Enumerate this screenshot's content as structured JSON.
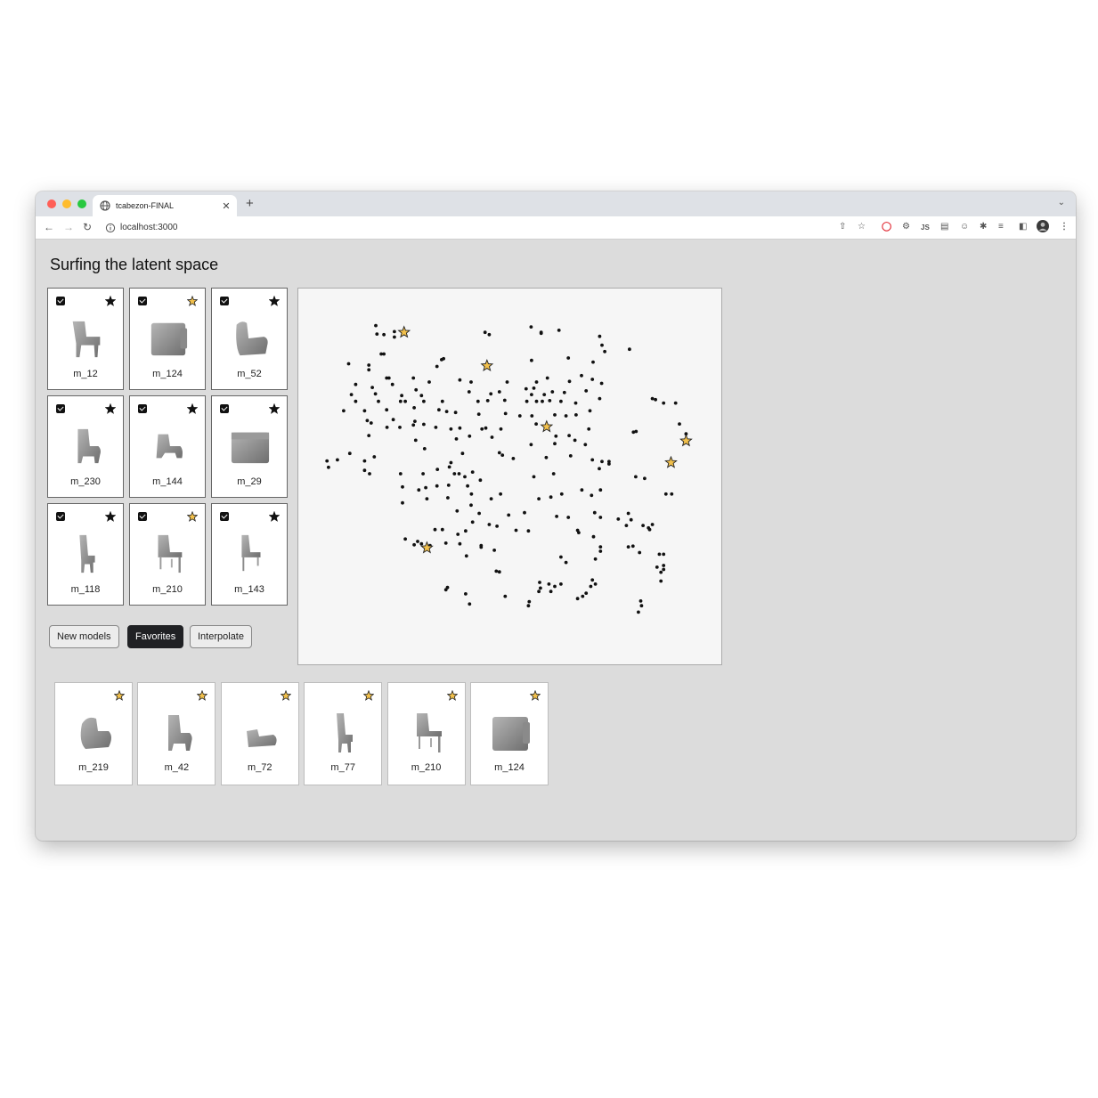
{
  "browser": {
    "tab_title": "tcabezon-FINAL",
    "new_tab_symbol": "+",
    "tab_close_symbol": "✕",
    "url": "localhost:3000",
    "extensions": [
      "share-icon",
      "bookmark-star-icon",
      "opera-icon",
      "gear-extension-icon",
      "js-extension-icon",
      "document-extension-icon",
      "smiley-extension-icon",
      "puzzle-icon",
      "media-list-icon",
      "sidebar-icon",
      "profile-avatar",
      "more-menu-icon"
    ],
    "js_label": "JS"
  },
  "page": {
    "title": "Surfing the latent space"
  },
  "grid_models": [
    {
      "label": "m_12",
      "checked": true,
      "favorite": false,
      "shape": "chair-armless"
    },
    {
      "label": "m_124",
      "checked": true,
      "favorite": true,
      "shape": "box-sofa"
    },
    {
      "label": "m_52",
      "checked": true,
      "favorite": false,
      "shape": "armchair"
    },
    {
      "label": "m_230",
      "checked": true,
      "favorite": false,
      "shape": "armchair-tall"
    },
    {
      "label": "m_144",
      "checked": true,
      "favorite": false,
      "shape": "armchair-low"
    },
    {
      "label": "m_29",
      "checked": true,
      "favorite": false,
      "shape": "box-sofa-wide"
    },
    {
      "label": "m_118",
      "checked": true,
      "favorite": false,
      "shape": "chair-slim"
    },
    {
      "label": "m_210",
      "checked": true,
      "favorite": true,
      "shape": "chair-legs"
    },
    {
      "label": "m_143",
      "checked": true,
      "favorite": false,
      "shape": "chair-legs-slim"
    }
  ],
  "buttons": {
    "new_models": "New models",
    "favorites": "Favorites",
    "interpolate": "Interpolate",
    "active": "favorites"
  },
  "favorites": [
    {
      "label": "m_219",
      "shape": "round-armchair"
    },
    {
      "label": "m_42",
      "shape": "armchair-tall"
    },
    {
      "label": "m_72",
      "shape": "low-seat"
    },
    {
      "label": "m_77",
      "shape": "chair-slim"
    },
    {
      "label": "m_210",
      "shape": "chair-legs"
    },
    {
      "label": "m_124",
      "shape": "box-sofa"
    }
  ],
  "colors": {
    "favorite_star": "#f2c04b",
    "star_outline": "#222222",
    "plain_star": "#111111",
    "active_button": "#202124",
    "window_bg": "#dcdcdc",
    "plot_bg": "#f6f6f6"
  },
  "chart_data": {
    "type": "scatter",
    "title": "",
    "xlabel": "",
    "ylabel": "",
    "grid": false,
    "axes": false,
    "xlim": [
      0,
      100
    ],
    "ylim": [
      0,
      100
    ],
    "series": [
      {
        "marker": "dot",
        "points": [
          [
            15.4,
            93.8
          ],
          [
            15.7,
            91.3
          ],
          [
            17.5,
            91.1
          ],
          [
            20.2,
            92.0
          ],
          [
            20.2,
            90.4
          ],
          [
            43.6,
            91.8
          ],
          [
            44.7,
            91.1
          ],
          [
            55.5,
            93.4
          ],
          [
            58.1,
            91.5
          ],
          [
            58.1,
            91.8
          ],
          [
            62.7,
            92.4
          ],
          [
            73.2,
            90.6
          ],
          [
            73.8,
            88.0
          ],
          [
            74.5,
            86.1
          ],
          [
            80.9,
            86.8
          ],
          [
            16.8,
            85.4
          ],
          [
            17.5,
            85.4
          ],
          [
            32.4,
            83.7
          ],
          [
            32.9,
            84.0
          ],
          [
            31.2,
            81.7
          ],
          [
            55.6,
            83.5
          ],
          [
            65.1,
            84.2
          ],
          [
            71.5,
            83.0
          ],
          [
            8.4,
            82.5
          ],
          [
            13.6,
            82.1
          ],
          [
            13.6,
            80.7
          ],
          [
            18.2,
            78.3
          ],
          [
            18.8,
            78.3
          ],
          [
            25.1,
            78.3
          ],
          [
            29.2,
            77.1
          ],
          [
            37.1,
            77.7
          ],
          [
            40.0,
            77.1
          ],
          [
            49.3,
            77.1
          ],
          [
            56.9,
            77.1
          ],
          [
            59.7,
            78.3
          ],
          [
            65.4,
            77.3
          ],
          [
            68.5,
            79.0
          ],
          [
            71.3,
            77.9
          ],
          [
            73.7,
            76.7
          ],
          [
            10.2,
            76.4
          ],
          [
            14.5,
            75.5
          ],
          [
            19.7,
            76.4
          ],
          [
            25.8,
            74.8
          ],
          [
            9.1,
            73.4
          ],
          [
            15.3,
            73.6
          ],
          [
            22.1,
            73.1
          ],
          [
            27.2,
            73.1
          ],
          [
            39.5,
            74.2
          ],
          [
            45.1,
            73.6
          ],
          [
            47.3,
            74.2
          ],
          [
            54.2,
            75.1
          ],
          [
            55.6,
            73.4
          ],
          [
            56.2,
            75.3
          ],
          [
            58.9,
            73.4
          ],
          [
            61.0,
            74.2
          ],
          [
            64.1,
            74.0
          ],
          [
            69.7,
            74.5
          ],
          [
            21.8,
            71.4
          ],
          [
            10.2,
            71.4
          ],
          [
            16.1,
            71.4
          ],
          [
            23.0,
            71.4
          ],
          [
            27.8,
            71.4
          ],
          [
            32.6,
            71.4
          ],
          [
            41.8,
            71.4
          ],
          [
            44.3,
            71.6
          ],
          [
            48.7,
            71.7
          ],
          [
            54.4,
            71.4
          ],
          [
            56.9,
            71.4
          ],
          [
            58.4,
            71.4
          ],
          [
            60.3,
            71.6
          ],
          [
            63.2,
            71.4
          ],
          [
            67.0,
            70.9
          ],
          [
            73.2,
            72.2
          ],
          [
            86.8,
            72.2
          ],
          [
            87.6,
            71.9
          ],
          [
            89.7,
            70.9
          ],
          [
            92.8,
            70.9
          ],
          [
            7.1,
            68.6
          ],
          [
            12.5,
            68.6
          ],
          [
            18.2,
            68.9
          ],
          [
            25.3,
            69.5
          ],
          [
            31.7,
            68.9
          ],
          [
            33.7,
            68.4
          ],
          [
            36.0,
            68.1
          ],
          [
            42.0,
            67.6
          ],
          [
            48.9,
            67.8
          ],
          [
            52.6,
            67.1
          ],
          [
            55.7,
            67.1
          ],
          [
            61.6,
            67.4
          ],
          [
            64.5,
            67.1
          ],
          [
            67.1,
            67.4
          ],
          [
            70.7,
            68.6
          ],
          [
            19.9,
            66.0
          ],
          [
            25.5,
            65.5
          ],
          [
            13.2,
            65.7
          ],
          [
            14.2,
            65.0
          ],
          [
            18.3,
            63.7
          ],
          [
            21.6,
            63.7
          ],
          [
            25.1,
            64.4
          ],
          [
            27.8,
            64.6
          ],
          [
            30.9,
            63.7
          ],
          [
            34.8,
            63.2
          ],
          [
            37.1,
            63.5
          ],
          [
            42.8,
            63.2
          ],
          [
            43.8,
            63.5
          ],
          [
            47.7,
            63.2
          ],
          [
            56.8,
            64.7
          ],
          [
            70.4,
            63.2
          ],
          [
            81.9,
            62.3
          ],
          [
            82.6,
            62.5
          ],
          [
            93.8,
            64.7
          ],
          [
            95.5,
            61.8
          ],
          [
            13.6,
            61.3
          ],
          [
            25.7,
            59.9
          ],
          [
            36.2,
            60.3
          ],
          [
            39.6,
            61.1
          ],
          [
            45.4,
            60.8
          ],
          [
            55.5,
            58.6
          ],
          [
            61.6,
            58.9
          ],
          [
            61.9,
            61.1
          ],
          [
            65.3,
            61.3
          ],
          [
            66.8,
            59.9
          ],
          [
            69.5,
            58.6
          ],
          [
            28.0,
            57.4
          ],
          [
            8.7,
            56.0
          ],
          [
            15.0,
            55.0
          ],
          [
            34.8,
            53.3
          ],
          [
            31.3,
            51.3
          ],
          [
            34.4,
            52.0
          ],
          [
            37.8,
            56.0
          ],
          [
            47.3,
            56.2
          ],
          [
            48.1,
            55.5
          ],
          [
            50.9,
            54.5
          ],
          [
            59.4,
            54.8
          ],
          [
            65.7,
            55.3
          ],
          [
            71.3,
            54.1
          ],
          [
            73.8,
            53.6
          ],
          [
            75.6,
            52.9
          ],
          [
            75.6,
            53.6
          ],
          [
            73.1,
            51.5
          ],
          [
            82.5,
            49.1
          ],
          [
            84.8,
            48.6
          ],
          [
            2.8,
            53.8
          ],
          [
            5.5,
            54.1
          ],
          [
            12.5,
            53.8
          ],
          [
            3.2,
            51.9
          ],
          [
            12.5,
            51.0
          ],
          [
            13.8,
            50.0
          ],
          [
            21.8,
            50.0
          ],
          [
            27.6,
            50.0
          ],
          [
            35.7,
            50.0
          ],
          [
            36.9,
            50.0
          ],
          [
            38.4,
            49.1
          ],
          [
            40.4,
            50.5
          ],
          [
            42.4,
            48.1
          ],
          [
            56.2,
            49.1
          ],
          [
            61.3,
            50.0
          ],
          [
            22.3,
            46.1
          ],
          [
            26.5,
            45.2
          ],
          [
            28.3,
            45.9
          ],
          [
            31.2,
            46.4
          ],
          [
            34.2,
            46.6
          ],
          [
            39.1,
            46.4
          ],
          [
            40.1,
            44.0
          ],
          [
            28.6,
            42.6
          ],
          [
            34.0,
            42.9
          ],
          [
            45.2,
            42.6
          ],
          [
            47.6,
            44.0
          ],
          [
            57.5,
            42.6
          ],
          [
            60.6,
            43.1
          ],
          [
            63.4,
            44.0
          ],
          [
            68.6,
            45.2
          ],
          [
            71.1,
            43.6
          ],
          [
            73.4,
            45.2
          ],
          [
            90.3,
            44.0
          ],
          [
            91.8,
            44.0
          ],
          [
            22.3,
            41.4
          ],
          [
            40.0,
            40.7
          ],
          [
            36.4,
            39.0
          ],
          [
            42.1,
            38.3
          ],
          [
            49.7,
            37.8
          ],
          [
            53.8,
            38.5
          ],
          [
            62.1,
            37.4
          ],
          [
            65.1,
            37.1
          ],
          [
            71.9,
            38.5
          ],
          [
            73.4,
            37.1
          ],
          [
            78.0,
            36.6
          ],
          [
            81.3,
            36.4
          ],
          [
            80.6,
            38.3
          ],
          [
            80.1,
            34.7
          ],
          [
            84.4,
            34.7
          ],
          [
            86.1,
            33.5
          ],
          [
            85.8,
            34.0
          ],
          [
            86.8,
            35.0
          ],
          [
            30.7,
            33.5
          ],
          [
            32.6,
            33.5
          ],
          [
            36.6,
            32.1
          ],
          [
            38.6,
            33.1
          ],
          [
            40.4,
            35.7
          ],
          [
            44.7,
            35.0
          ],
          [
            46.7,
            34.5
          ],
          [
            51.6,
            33.3
          ],
          [
            54.8,
            33.1
          ],
          [
            67.5,
            33.3
          ],
          [
            71.6,
            31.4
          ],
          [
            67.8,
            32.6
          ],
          [
            73.4,
            28.4
          ],
          [
            80.6,
            28.4
          ],
          [
            81.8,
            28.6
          ],
          [
            83.5,
            26.7
          ],
          [
            88.6,
            26.2
          ],
          [
            89.7,
            26.2
          ],
          [
            38.8,
            25.7
          ],
          [
            23.0,
            30.7
          ],
          [
            25.3,
            29.0
          ],
          [
            26.2,
            30.0
          ],
          [
            27.2,
            29.3
          ],
          [
            29.4,
            28.8
          ],
          [
            33.5,
            29.5
          ],
          [
            37.1,
            29.3
          ],
          [
            42.6,
            28.8
          ],
          [
            42.6,
            28.3
          ],
          [
            46.0,
            27.4
          ],
          [
            63.2,
            25.4
          ],
          [
            64.5,
            23.8
          ],
          [
            72.1,
            24.8
          ],
          [
            73.4,
            27.1
          ],
          [
            88.0,
            22.4
          ],
          [
            89.7,
            22.9
          ],
          [
            89.7,
            21.7
          ],
          [
            89.0,
            20.9
          ],
          [
            89.0,
            18.3
          ],
          [
            46.5,
            21.2
          ],
          [
            47.3,
            21.0
          ],
          [
            57.7,
            17.9
          ],
          [
            60.1,
            17.4
          ],
          [
            63.2,
            17.4
          ],
          [
            70.9,
            16.7
          ],
          [
            72.1,
            17.4
          ],
          [
            71.3,
            18.6
          ],
          [
            61.6,
            16.7
          ],
          [
            57.5,
            15.2
          ],
          [
            57.9,
            16.2
          ],
          [
            60.6,
            15.2
          ],
          [
            48.8,
            13.8
          ],
          [
            33.5,
            15.7
          ],
          [
            33.9,
            16.4
          ],
          [
            38.6,
            14.5
          ],
          [
            39.6,
            11.5
          ],
          [
            55.0,
            12.2
          ],
          [
            54.8,
            11.0
          ],
          [
            67.5,
            13.1
          ],
          [
            68.8,
            13.8
          ],
          [
            69.7,
            14.7
          ],
          [
            83.8,
            12.4
          ],
          [
            84.0,
            11.0
          ],
          [
            83.2,
            9.1
          ]
        ]
      },
      {
        "marker": "star",
        "points": [
          [
            22.7,
            91.8
          ],
          [
            44.1,
            81.9
          ],
          [
            59.5,
            63.9
          ],
          [
            95.5,
            59.7
          ],
          [
            91.6,
            53.3
          ],
          [
            28.6,
            28.1
          ]
        ]
      }
    ]
  }
}
